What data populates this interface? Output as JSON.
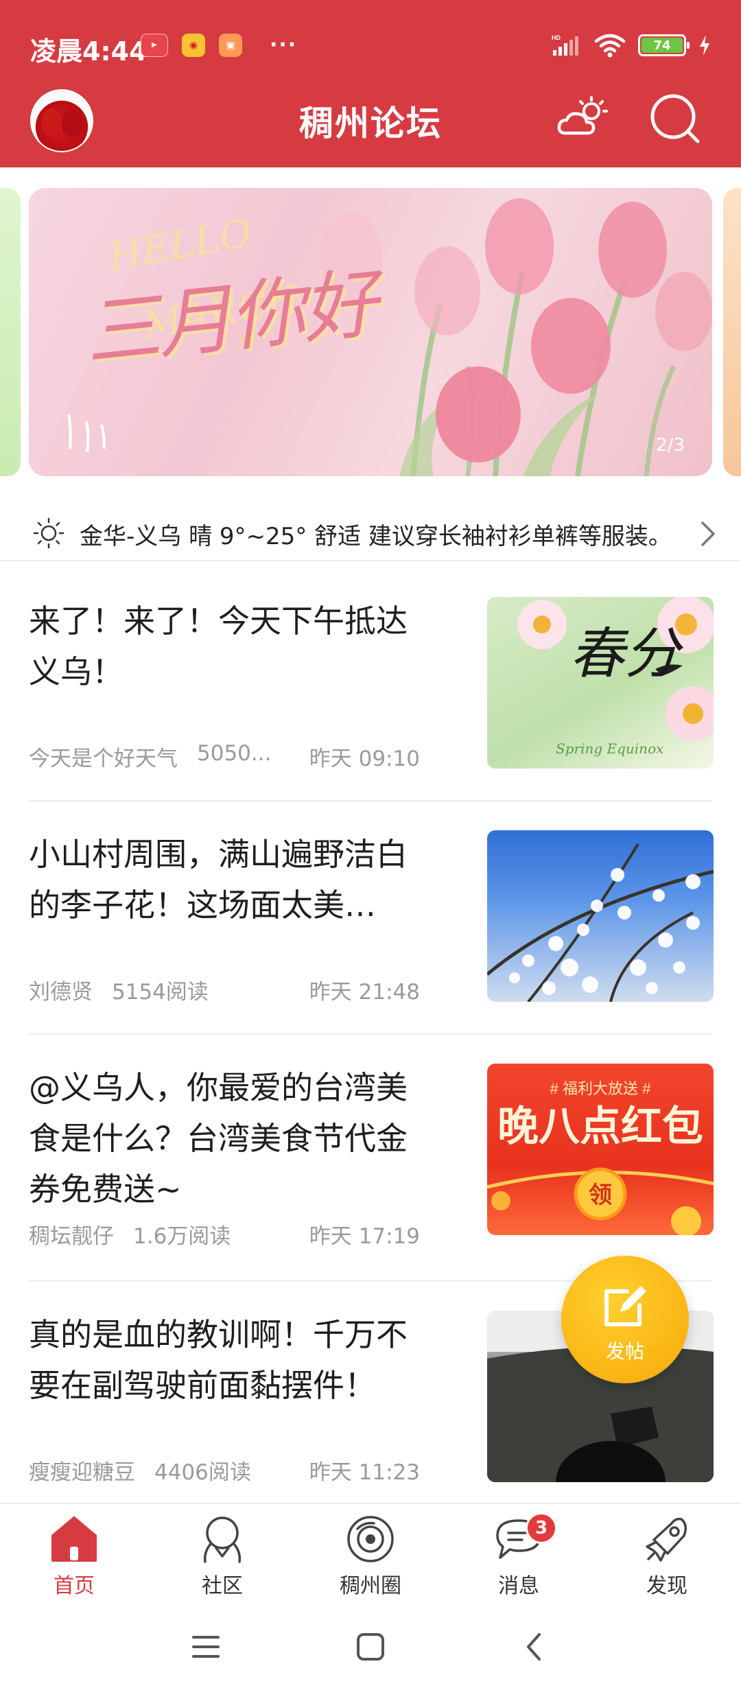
{
  "status_bar": {
    "time": "凌晨4:44",
    "notif_icons": [
      "video-app-icon",
      "weibo-icon",
      "shopping-app-icon"
    ],
    "more": "···",
    "network_label": "HD",
    "battery": "74"
  },
  "app_bar": {
    "title": "稠州论坛",
    "icons": [
      "avatar",
      "weather-icon",
      "search-icon"
    ]
  },
  "banner": {
    "title": "三月你好",
    "page_indicator": "2/3"
  },
  "weather_tip": {
    "text": "金华-义乌 晴 9°~25° 舒适 建议穿长袖衬衫单裤等服装。"
  },
  "articles": [
    {
      "title": "来了！来了！今天下午抵达义乌！",
      "author": "今天是个好天气",
      "reads": "5050...",
      "time": "昨天 09:10",
      "thumb_label": "春分",
      "thumb_sub": "Spring Equinox"
    },
    {
      "title": "小山村周围，满山遍野洁白的李子花！这场面太美…",
      "author": "刘德贤",
      "reads": "5154阅读",
      "time": "昨天 21:48"
    },
    {
      "title": "@义乌人，你最爱的台湾美食是什么？台湾美食节代金券免费送~",
      "author": "稠坛靓仔",
      "reads": "1.6万阅读",
      "time": "昨天 17:19",
      "thumb_tag": "# 福利大放送 #",
      "thumb_label": "晚八点红包",
      "thumb_coin": "领"
    },
    {
      "title": "真的是血的教训啊！千万不要在副驾驶前面黏摆件！",
      "author": "瘦瘦迎糖豆",
      "reads": "4406阅读",
      "time": "昨天 11:23"
    }
  ],
  "fab": {
    "label": "发帖"
  },
  "bottom_nav": [
    {
      "label": "首页",
      "icon": "home-icon",
      "active": true
    },
    {
      "label": "社区",
      "icon": "community-icon",
      "active": false
    },
    {
      "label": "稠州圈",
      "icon": "circle-icon",
      "active": false
    },
    {
      "label": "消息",
      "icon": "message-icon",
      "active": false,
      "badge": "3"
    },
    {
      "label": "发现",
      "icon": "discover-icon",
      "active": false
    }
  ],
  "colors": {
    "brand": "#d63b42",
    "fab": "#fbb817",
    "meta_text": "#9a9a9a"
  }
}
